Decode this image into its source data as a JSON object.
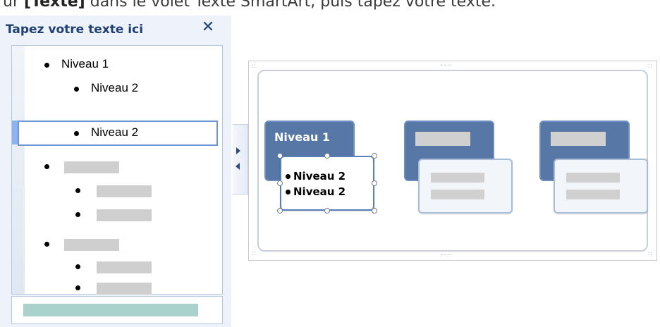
{
  "caption": {
    "prefix": "ur ",
    "bold": "[Texte]",
    "rest": " dans le volet Texte SmartArt, puis tapez votre texte."
  },
  "text_pane": {
    "title": "Tapez votre texte ici",
    "close_glyph": "✕",
    "items": [
      {
        "level": 1,
        "text": "Niveau 1"
      },
      {
        "level": 2,
        "text": "Niveau 2"
      },
      {
        "level": 2,
        "text": "Niveau 2",
        "selected": true
      }
    ],
    "placeholder_groups": 2
  },
  "smartart": {
    "shape1": {
      "main_label": "Niveau 1",
      "sub_lines": [
        "Niveau 2",
        "Niveau 2"
      ]
    },
    "handle_glyph": "····"
  },
  "colors": {
    "accent_dark": "#5777a6",
    "title_text": "#1f3f73",
    "placeholder": "#cfcfcf",
    "selection": "#6f95d4"
  }
}
